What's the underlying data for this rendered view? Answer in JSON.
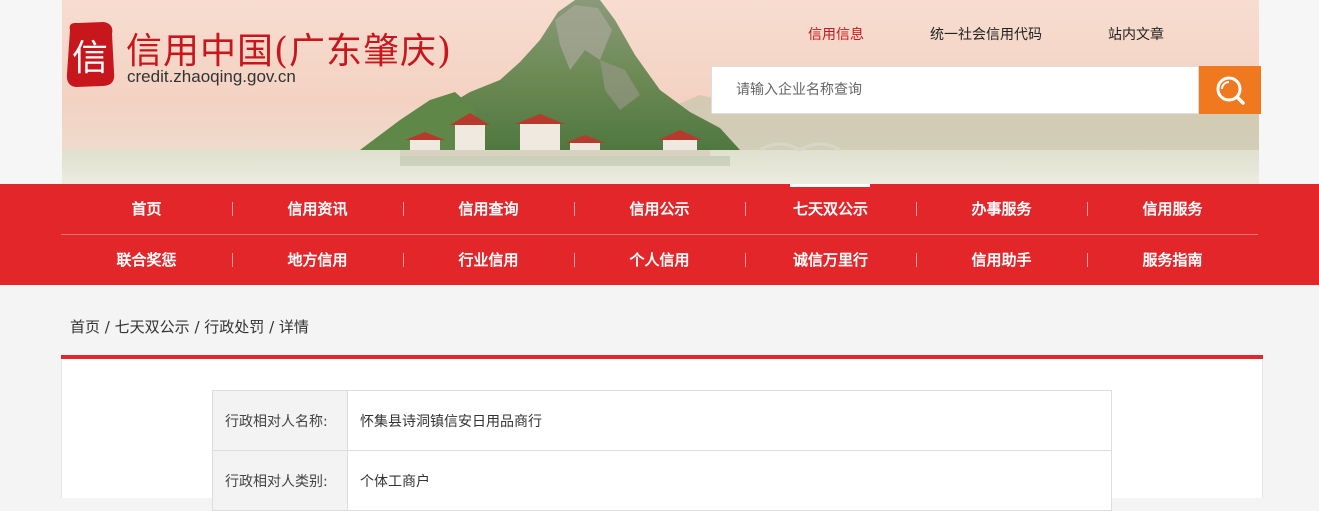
{
  "site": {
    "seal_char": "信",
    "name": "信用中国(广东肇庆)",
    "domain": "credit.zhaoqing.gov.cn"
  },
  "top_links": [
    {
      "label": "信用信息",
      "active": true
    },
    {
      "label": "统一社会信用代码",
      "active": false
    },
    {
      "label": "站内文章",
      "active": false
    }
  ],
  "search": {
    "placeholder": "请输入企业名称查询",
    "value": "",
    "button_icon": "search-icon"
  },
  "nav": {
    "row1": [
      "首页",
      "信用资讯",
      "信用查询",
      "信用公示",
      "七天双公示",
      "办事服务",
      "信用服务"
    ],
    "row2": [
      "联合奖惩",
      "地方信用",
      "行业信用",
      "个人信用",
      "诚信万里行",
      "信用助手",
      "服务指南"
    ],
    "active": "七天双公示"
  },
  "breadcrumb": {
    "items": [
      "首页",
      "七天双公示",
      "行政处罚",
      "详情"
    ],
    "separator": "/"
  },
  "detail": {
    "rows": [
      {
        "key": "行政相对人名称:",
        "value": "怀集县诗洞镇信安日用品商行"
      },
      {
        "key": "行政相对人类别:",
        "value": "个体工商户"
      }
    ]
  },
  "colors": {
    "brand_red": "#e3262a",
    "title_red": "#c8161d",
    "search_orange": "#f0781e"
  }
}
